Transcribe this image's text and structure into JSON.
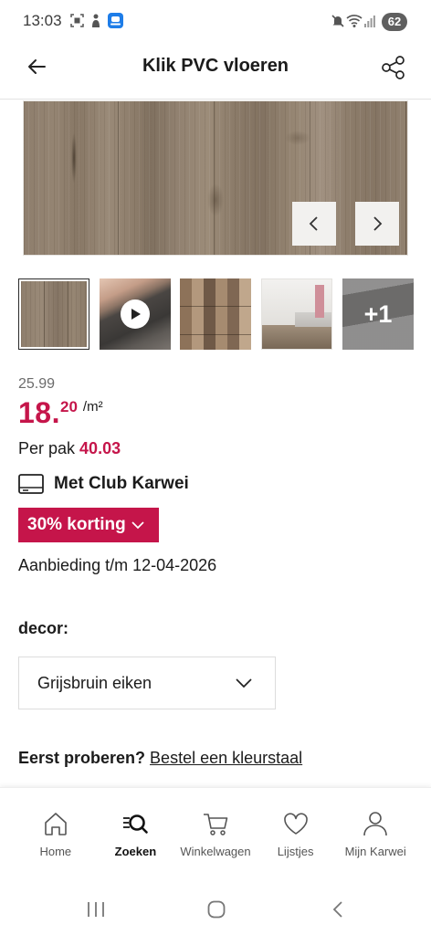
{
  "status_bar": {
    "time": "13:03",
    "battery": "62",
    "icons": [
      "screen-record-icon",
      "figure-icon",
      "app-icon",
      "mute-icon",
      "wifi-icon",
      "signal-icon",
      "battery-icon"
    ]
  },
  "header": {
    "title": "Klik PVC vloeren",
    "back_icon": "arrow-left-icon",
    "share_icon": "share-icon"
  },
  "gallery": {
    "prev_icon": "chevron-left-icon",
    "next_icon": "chevron-right-icon",
    "selected_index": 0,
    "video_icon": "play-icon",
    "more_label": "+1"
  },
  "price": {
    "old": "25.99",
    "main_int": "18.",
    "main_dec": "20",
    "unit": "/m²"
  },
  "per_pack": {
    "label": "Per pak",
    "value": "40.03"
  },
  "club": {
    "icon": "card-icon",
    "label": "Met Club Karwei"
  },
  "discount": {
    "label": "30% korting",
    "icon": "chevron-down-icon"
  },
  "offer": {
    "text": "Aanbieding t/m 12-04-2026"
  },
  "decor": {
    "label": "decor:",
    "selected": "Grijsbruin eiken",
    "icon": "chevron-down-icon"
  },
  "sample": {
    "question": "Eerst proberen?",
    "link": "Bestel een kleurstaal"
  },
  "bottom_nav": {
    "items": [
      {
        "label": "Home",
        "icon": "home-icon"
      },
      {
        "label": "Zoeken",
        "icon": "search-icon",
        "active": true
      },
      {
        "label": "Winkelwagen",
        "icon": "cart-icon"
      },
      {
        "label": "Lijstjes",
        "icon": "heart-icon"
      },
      {
        "label": "Mijn Karwei",
        "icon": "user-icon"
      }
    ]
  },
  "system_nav": {
    "icons": [
      "recents-icon",
      "home-circle-icon",
      "back-icon"
    ]
  },
  "colors": {
    "accent": "#c5154a",
    "text": "#1b1b1b",
    "muted": "#6b6b6b",
    "border": "#dcdcdc",
    "app_icon": "#1e7de8"
  }
}
